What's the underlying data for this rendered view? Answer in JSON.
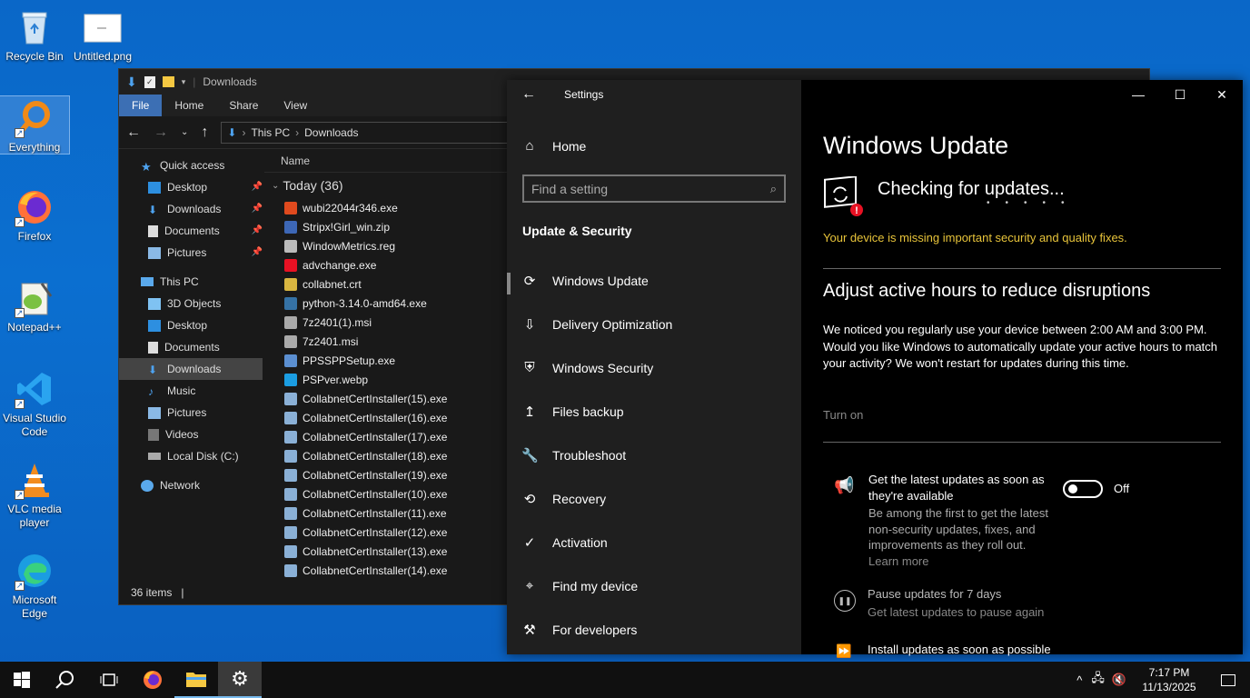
{
  "desktop": {
    "icons": [
      {
        "label": "Recycle Bin",
        "icon": "recycle-bin-icon"
      },
      {
        "label": "Untitled.png",
        "icon": "image-file-icon"
      },
      {
        "label": "Everything",
        "icon": "everything-search-icon"
      },
      {
        "label": "Firefox",
        "icon": "firefox-icon"
      },
      {
        "label": "Notepad++",
        "icon": "notepadpp-icon"
      },
      {
        "label": "Visual Studio Code",
        "icon": "vscode-icon"
      },
      {
        "label": "VLC media player",
        "icon": "vlc-icon"
      },
      {
        "label": "Microsoft Edge",
        "icon": "edge-icon"
      }
    ]
  },
  "explorer": {
    "title": "Downloads",
    "ribbon_tabs": [
      "File",
      "Home",
      "Share",
      "View"
    ],
    "breadcrumb": [
      "This PC",
      "Downloads"
    ],
    "nav": [
      {
        "label": "Quick access",
        "pinned": false
      },
      {
        "label": "Desktop",
        "pinned": true
      },
      {
        "label": "Downloads",
        "pinned": true
      },
      {
        "label": "Documents",
        "pinned": true
      },
      {
        "label": "Pictures",
        "pinned": true
      },
      {
        "label": "This PC",
        "pinned": false
      },
      {
        "label": "3D Objects",
        "pinned": false
      },
      {
        "label": "Desktop",
        "pinned": false
      },
      {
        "label": "Documents",
        "pinned": false
      },
      {
        "label": "Downloads",
        "pinned": false
      },
      {
        "label": "Music",
        "pinned": false
      },
      {
        "label": "Pictures",
        "pinned": false
      },
      {
        "label": "Videos",
        "pinned": false
      },
      {
        "label": "Local Disk (C:)",
        "pinned": false
      },
      {
        "label": "Network",
        "pinned": false
      }
    ],
    "column_header": "Name",
    "group_label": "Today (36)",
    "files": [
      "wubi22044r346.exe",
      "Stripx!Girl_win.zip",
      "WindowMetrics.reg",
      "advchange.exe",
      "collabnet.crt",
      "python-3.14.0-amd64.exe",
      "7z2401(1).msi",
      "7z2401.msi",
      "PPSSPPSetup.exe",
      "PSPver.webp",
      "CollabnetCertInstaller(15).exe",
      "CollabnetCertInstaller(16).exe",
      "CollabnetCertInstaller(17).exe",
      "CollabnetCertInstaller(18).exe",
      "CollabnetCertInstaller(19).exe",
      "CollabnetCertInstaller(10).exe",
      "CollabnetCertInstaller(11).exe",
      "CollabnetCertInstaller(12).exe",
      "CollabnetCertInstaller(13).exe",
      "CollabnetCertInstaller(14).exe"
    ],
    "status": "36 items"
  },
  "settings": {
    "title": "Settings",
    "home": "Home",
    "search_placeholder": "Find a setting",
    "section": "Update & Security",
    "nav": [
      {
        "label": "Windows Update",
        "icon": "sync-icon"
      },
      {
        "label": "Delivery Optimization",
        "icon": "delivery-optimization-icon"
      },
      {
        "label": "Windows Security",
        "icon": "shield-icon"
      },
      {
        "label": "Files backup",
        "icon": "backup-arrow-icon"
      },
      {
        "label": "Troubleshoot",
        "icon": "wrench-icon"
      },
      {
        "label": "Recovery",
        "icon": "recovery-icon"
      },
      {
        "label": "Activation",
        "icon": "check-circle-icon"
      },
      {
        "label": "Find my device",
        "icon": "find-device-icon"
      },
      {
        "label": "For developers",
        "icon": "developer-tools-icon"
      }
    ],
    "page_title": "Windows Update",
    "status": "Checking for updates...",
    "warning": "Your device is missing important security and quality fixes.",
    "active_hours_title": "Adjust active hours to reduce disruptions",
    "active_hours_text": "We noticed you regularly use your device between 2:00 AM and 3:00 PM. Would you like Windows to automatically update your active hours to match your activity? We won't restart for updates during this time.",
    "turn_on": "Turn on",
    "latest_title": "Get the latest updates as soon as they're available",
    "latest_desc": "Be among the first to get the latest non-security updates, fixes, and improvements as they roll out.",
    "learn_more": "Learn more",
    "toggle_state": "Off",
    "pause_title": "Pause updates for 7 days",
    "pause_desc": "Get latest updates to pause again",
    "install_title": "Install updates as soon as possible",
    "warn_color": "#e8c43a",
    "error_color": "#e81123"
  },
  "taskbar": {
    "apps": [
      "start-icon",
      "search-icon",
      "task-view-icon",
      "firefox-icon",
      "file-explorer-icon",
      "settings-icon"
    ],
    "time": "7:17 PM",
    "date": "11/13/2025"
  }
}
